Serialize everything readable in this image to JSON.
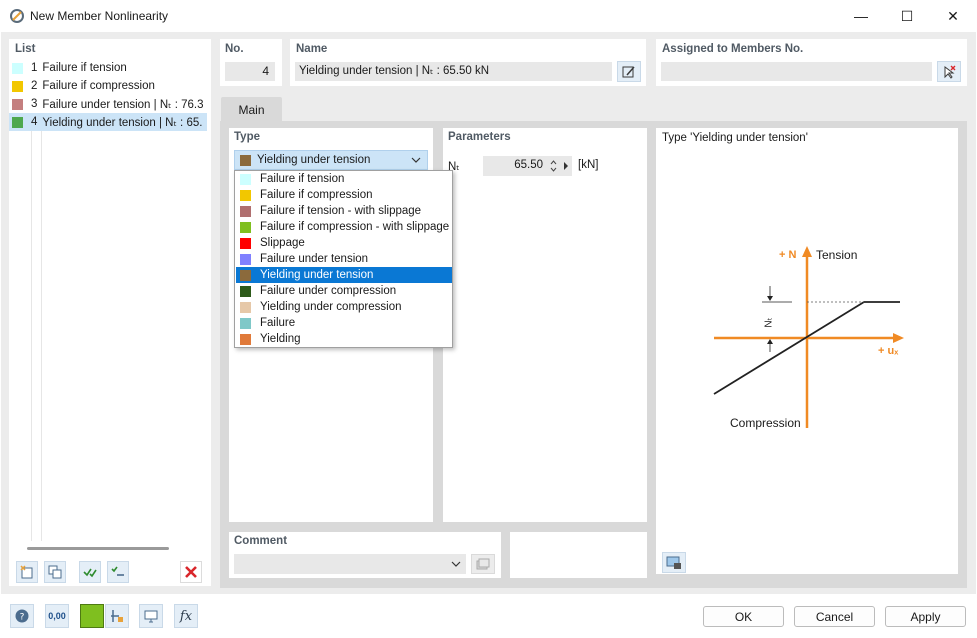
{
  "window": {
    "title": "New Member Nonlinearity",
    "minimize": "—",
    "maximize": "☐",
    "close": "✕"
  },
  "list": {
    "header": "List",
    "items": [
      {
        "no": "1",
        "label": "Failure if tension",
        "color": "#ccffff"
      },
      {
        "no": "2",
        "label": "Failure if compression",
        "color": "#f2c700"
      },
      {
        "no": "3",
        "label": "Failure under tension | Nₜ : 76.3",
        "color": "#c47f7f"
      },
      {
        "no": "4",
        "label": "Yielding under tension | Nₜ : 65.",
        "color": "#4ea84e"
      }
    ],
    "selected_index": 3
  },
  "no_field": {
    "header": "No.",
    "value": "4"
  },
  "name_field": {
    "header": "Name",
    "value": "Yielding under tension | Nₜ : 65.50 kN"
  },
  "assigned_field": {
    "header": "Assigned to Members No.",
    "value": ""
  },
  "tabs": [
    {
      "label": "Main"
    }
  ],
  "type_section": {
    "header": "Type",
    "selected": "Yielding under tension",
    "selected_color": "#8b6a3c",
    "options": [
      {
        "label": "Failure if tension",
        "color": "#ccffff"
      },
      {
        "label": "Failure if compression",
        "color": "#f2c700"
      },
      {
        "label": "Failure if tension - with slippage",
        "color": "#b06f6f"
      },
      {
        "label": "Failure if compression - with slippage",
        "color": "#7fbf1f"
      },
      {
        "label": "Slippage",
        "color": "#ff0000"
      },
      {
        "label": "Failure under tension",
        "color": "#8080ff"
      },
      {
        "label": "Yielding under tension",
        "color": "#8b6a3c"
      },
      {
        "label": "Failure under compression",
        "color": "#2d5a1a"
      },
      {
        "label": "Yielding under compression",
        "color": "#e6c8a8"
      },
      {
        "label": "Failure",
        "color": "#7fc8c8"
      },
      {
        "label": "Yielding",
        "color": "#e07a3a"
      }
    ],
    "highlighted_index": 6
  },
  "parameters": {
    "header": "Parameters",
    "label": "Nₜ",
    "value": "65.50",
    "unit": "[kN]"
  },
  "diagram": {
    "title": "Type 'Yielding under tension'",
    "axis_n": "+ N",
    "tension": "Tension",
    "axis_u": "+ uₓ",
    "compression": "Compression",
    "nt_label": "Nₜ",
    "accent": "#f08a24"
  },
  "comment": {
    "header": "Comment",
    "value": ""
  },
  "buttons": {
    "ok": "OK",
    "cancel": "Cancel",
    "apply": "Apply"
  },
  "bottom_decimal_icon": "0,00"
}
